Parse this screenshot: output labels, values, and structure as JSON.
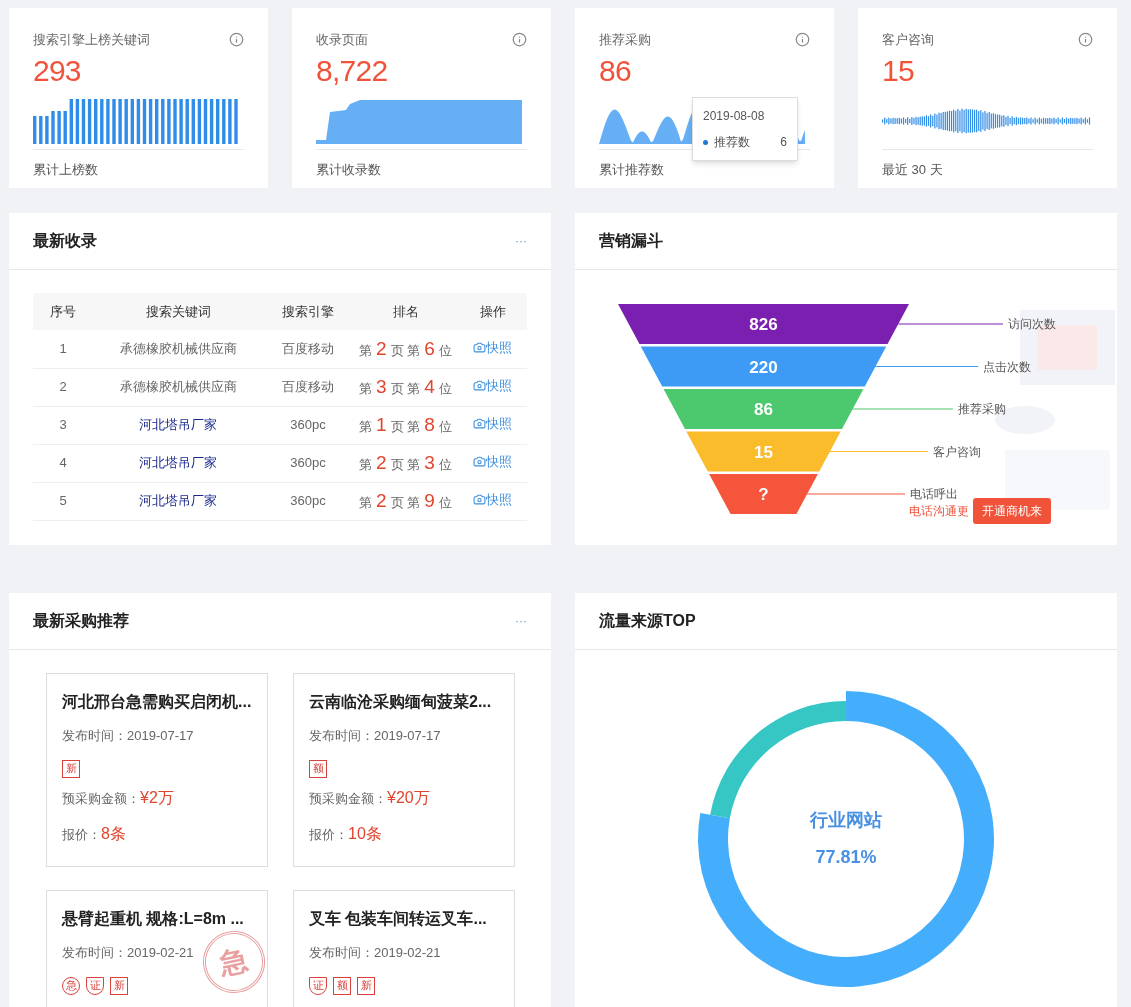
{
  "stats": [
    {
      "title": "搜索引擎上榜关键词",
      "value": "293",
      "footer": "累计上榜数",
      "kind": "bars"
    },
    {
      "title": "收录页面",
      "value": "8,722",
      "footer": "累计收录数",
      "kind": "area"
    },
    {
      "title": "推荐采购",
      "value": "86",
      "footer": "累计推荐数",
      "kind": "wave",
      "tooltip": {
        "date": "2019-08-08",
        "label": "推荐数",
        "value": "6"
      }
    },
    {
      "title": "客户咨询",
      "value": "15",
      "footer": "最近 30 天",
      "kind": "ticks"
    }
  ],
  "recent": {
    "title": "最新收录",
    "more": "···",
    "table": {
      "columns": [
        "序号",
        "搜索关键词",
        "搜索引擎",
        "排名",
        "操作"
      ],
      "rows": [
        {
          "index": "1",
          "keyword": "承德橡胶机械供应商",
          "link": false,
          "engine": "百度移动",
          "rank": [
            {
              "text": "第",
              "kind": "text"
            },
            {
              "text": "2",
              "kind": "num"
            },
            {
              "text": "页 第",
              "kind": "text"
            },
            {
              "text": "6",
              "kind": "num"
            },
            {
              "text": "位",
              "kind": "text"
            }
          ],
          "action": "快照"
        },
        {
          "index": "2",
          "keyword": "承德橡胶机械供应商",
          "link": false,
          "engine": "百度移动",
          "rank": [
            {
              "text": "第",
              "kind": "text"
            },
            {
              "text": "3",
              "kind": "num"
            },
            {
              "text": "页 第",
              "kind": "text"
            },
            {
              "text": "4",
              "kind": "num"
            },
            {
              "text": "位",
              "kind": "text"
            }
          ],
          "action": "快照"
        },
        {
          "index": "3",
          "keyword": "河北塔吊厂家",
          "link": true,
          "engine": "360pc",
          "rank": [
            {
              "text": "第",
              "kind": "text"
            },
            {
              "text": "1",
              "kind": "num"
            },
            {
              "text": "页 第",
              "kind": "text"
            },
            {
              "text": "8",
              "kind": "num"
            },
            {
              "text": "位",
              "kind": "text"
            }
          ],
          "action": "快照"
        },
        {
          "index": "4",
          "keyword": "河北塔吊厂家",
          "link": true,
          "engine": "360pc",
          "rank": [
            {
              "text": "第",
              "kind": "text"
            },
            {
              "text": "2",
              "kind": "num"
            },
            {
              "text": "页 第",
              "kind": "text"
            },
            {
              "text": "3",
              "kind": "num"
            },
            {
              "text": "位",
              "kind": "text"
            }
          ],
          "action": "快照"
        },
        {
          "index": "5",
          "keyword": "河北塔吊厂家",
          "link": true,
          "engine": "360pc",
          "rank": [
            {
              "text": "第",
              "kind": "text"
            },
            {
              "text": "2",
              "kind": "num"
            },
            {
              "text": "页 第",
              "kind": "text"
            },
            {
              "text": "9",
              "kind": "num"
            },
            {
              "text": "位",
              "kind": "text"
            }
          ],
          "action": "快照"
        }
      ]
    }
  },
  "funnel": {
    "title": "营销漏斗",
    "stages": [
      {
        "value": "826",
        "label": "访问次数",
        "color": "#7b1fb0"
      },
      {
        "value": "220",
        "label": "点击次数",
        "color": "#3d9bf5"
      },
      {
        "value": "86",
        "label": "推荐采购",
        "color": "#4cc86f"
      },
      {
        "value": "15",
        "label": "客户咨询",
        "color": "#fbbc2c"
      },
      {
        "value": "?",
        "label": "电话呼出",
        "color": "#f5553a"
      }
    ],
    "note": "电话沟通更",
    "button": "开通商机来"
  },
  "purchases": {
    "title": "最新采购推荐",
    "more": "···",
    "cards": [
      {
        "title": "河北邢台急需购买启闭机...",
        "date": "发布时间：2019-07-17",
        "tags": [
          {
            "text": "新",
            "kind": "square"
          }
        ],
        "amount_label": "预采购金额：",
        "amount": "¥2万",
        "quote_label": "报价：",
        "quote": "8条"
      },
      {
        "title": "云南临沧采购缅甸菠菜2...",
        "date": "发布时间：2019-07-17",
        "tags": [
          {
            "text": "额",
            "kind": "square"
          }
        ],
        "amount_label": "预采购金额：",
        "amount": "¥20万",
        "quote_label": "报价：",
        "quote": "10条"
      },
      {
        "title": "悬臂起重机 规格:L=8m ...",
        "date": "发布时间：2019-02-21",
        "tags": [
          {
            "text": "急",
            "kind": "circle"
          },
          {
            "text": "证",
            "kind": "shield"
          },
          {
            "text": "新",
            "kind": "square"
          }
        ],
        "stamp": "急"
      },
      {
        "title": "叉车 包装车间转运叉车...",
        "date": "发布时间：2019-02-21",
        "tags": [
          {
            "text": "证",
            "kind": "shield"
          },
          {
            "text": "额",
            "kind": "square"
          },
          {
            "text": "新",
            "kind": "square"
          }
        ]
      }
    ]
  },
  "traffic": {
    "title": "流量来源TOP",
    "source": "行业网站",
    "share": "77.81%",
    "chart_data": {
      "type": "donut",
      "values": [
        77.81,
        22.19
      ]
    }
  }
}
